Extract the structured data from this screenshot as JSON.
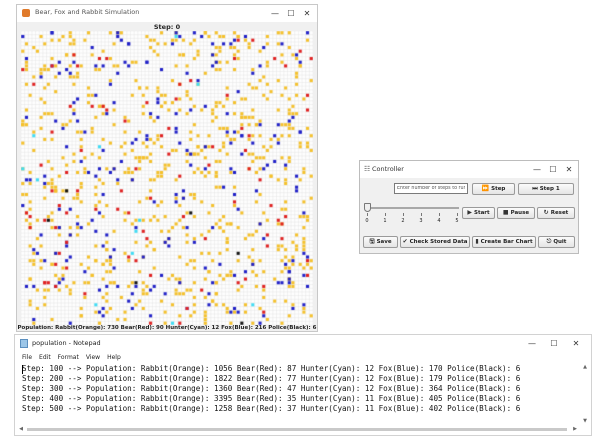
{
  "simulation": {
    "title": "Bear, Fox and Rabbit Simulation",
    "step_text": "Step: 0",
    "population_text": "Population: Rabbit(Orange): 730 Bear(Red): 90 Hunter(Cyan): 12 Fox(Blue): 216 Police(Black): 6",
    "legend_colors": {
      "rabbit": "#f5c12b",
      "bear": "#e02020",
      "hunter": "#3fdcf5",
      "fox": "#2020c8",
      "police": "#111111",
      "empty": "#ffffff",
      "gridline": "#e3e3e3"
    },
    "grid_cols": 80,
    "grid_rows": 80
  },
  "controller": {
    "title": "Controller",
    "app_icon": "grip-icon",
    "steps_placeholder": "Enter number of steps to run",
    "step_button": "Step",
    "step1_button": "Step 1",
    "start_button": "Start",
    "pause_button": "Pause",
    "reset_button": "Reset",
    "save_button": "Save",
    "check_button": "Check Stored Data",
    "bar_chart_button": "Create Bar Chart",
    "quit_button": "Quit",
    "slider_value": 0,
    "slider_ticks": [
      "0",
      "1",
      "2",
      "3",
      "4",
      "5"
    ]
  },
  "notepad": {
    "title": "population - Notepad",
    "menus": [
      "File",
      "Edit",
      "Format",
      "View",
      "Help"
    ],
    "lines": [
      "Step: 100 --> Population: Rabbit(Orange): 1056 Bear(Red): 87 Hunter(Cyan): 12 Fox(Blue): 170 Police(Black): 6",
      "Step: 200 --> Population: Rabbit(Orange): 1822 Bear(Red): 77 Hunter(Cyan): 12 Fox(Blue): 179 Police(Black): 6",
      "Step: 300 --> Population: Rabbit(Orange): 1360 Bear(Red): 47 Hunter(Cyan): 12 Fox(Blue): 364 Police(Black): 6",
      "Step: 400 --> Population: Rabbit(Orange): 3395 Bear(Red): 35 Hunter(Cyan): 11 Fox(Blue): 405 Police(Black): 6",
      "Step: 500 --> Population: Rabbit(Orange): 1258 Bear(Red): 37 Hunter(Cyan): 11 Fox(Blue): 402 Police(Black): 6"
    ]
  },
  "window_controls": {
    "minimize": "—",
    "maximize": "☐",
    "close": "✕"
  }
}
